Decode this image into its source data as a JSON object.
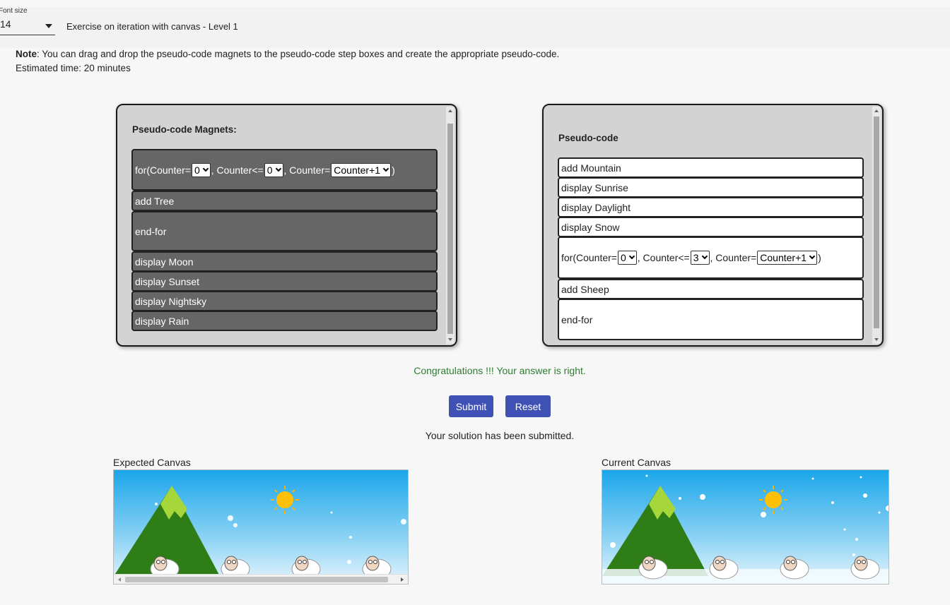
{
  "toolbar": {
    "font_size_label": "Font size",
    "font_size_value": "14",
    "exercise_title": "Exercise on iteration with canvas - Level 1"
  },
  "note": {
    "label": "Note",
    "text": ": You can drag and drop the pseudo-code magnets to the pseudo-code step boxes and create the appropriate pseudo-code.",
    "estimated_time": "Estimated time: 20 minutes"
  },
  "magnets_panel": {
    "title": "Pseudo-code Magnets:",
    "for_loop": {
      "prefix": "for(Counter=",
      "start_value": "0",
      "mid": ", Counter<=",
      "end_value": "0",
      "mid2": ", Counter=",
      "step_value": "Counter+1",
      "suffix": " )"
    },
    "items": [
      "add Tree",
      "end-for",
      "display Moon",
      "display Sunset",
      "display Nightsky",
      "display Rain"
    ]
  },
  "pseudocode_panel": {
    "title": "Pseudo-code",
    "items_before": [
      "add Mountain",
      "display Sunrise",
      "display Daylight",
      "display Snow"
    ],
    "for_loop": {
      "prefix": "for(Counter=",
      "start_value": "0",
      "mid": ", Counter<=",
      "end_value": "3",
      "mid2": ", Counter=",
      "step_value": "Counter+1",
      "suffix": " )"
    },
    "items_after": [
      "add Sheep",
      "end-for"
    ]
  },
  "feedback": {
    "congrats": "Congratulations !!! Your answer is right.",
    "submit_label": "Submit",
    "reset_label": "Reset",
    "submitted": "Your solution has been submitted."
  },
  "canvases": {
    "expected_label": "Expected Canvas",
    "current_label": "Current Canvas"
  },
  "colors": {
    "button": "#3f51b5",
    "success_text": "#2e7d32",
    "magnet_bg": "#666666",
    "panel_bg": "#d3d3d3"
  }
}
